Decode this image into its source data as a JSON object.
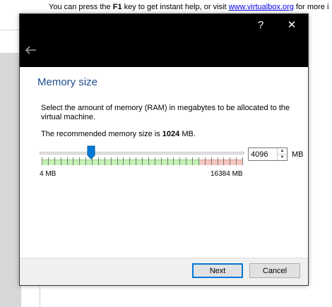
{
  "background": {
    "help_prefix": "You can press the ",
    "help_key": "F1",
    "help_middle": " key to get instant help, or visit ",
    "help_link": "www.virtualbox.org",
    "help_suffix": " for more i"
  },
  "dialog": {
    "help_glyph": "?",
    "close_glyph": "✕",
    "page_title": "Memory size",
    "description": "Select the amount of memory (RAM) in megabytes to be allocated to the virtual machine.",
    "recommended_prefix": "The recommended memory size is ",
    "recommended_value": "1024",
    "recommended_suffix": " MB.",
    "memory": {
      "value": "4096",
      "unit": "MB",
      "min_label": "4 MB",
      "max_label": "16384 MB",
      "slider_fraction": 0.25
    },
    "buttons": {
      "next": "Next",
      "cancel": "Cancel"
    }
  }
}
